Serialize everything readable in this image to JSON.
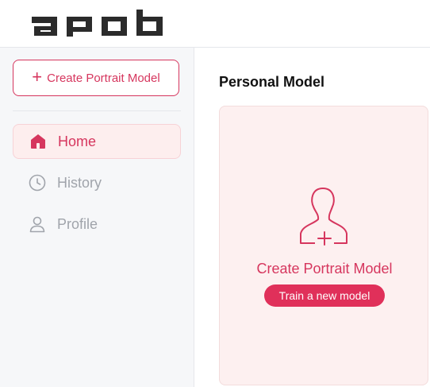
{
  "app": {
    "logo_text": "apob"
  },
  "sidebar": {
    "create_button_label": "Create Portrait Model",
    "items": [
      {
        "label": "Home",
        "icon": "home-icon",
        "active": true
      },
      {
        "label": "History",
        "icon": "clock-icon",
        "active": false
      },
      {
        "label": "Profile",
        "icon": "user-icon",
        "active": false
      }
    ]
  },
  "main": {
    "section_title": "Personal Model",
    "card": {
      "icon": "portrait-add-icon",
      "title": "Create Portrait Model",
      "button_label": "Train a new model"
    }
  },
  "colors": {
    "accent": "#d6365e",
    "accent_button": "#e0305a",
    "card_bg": "#fdf0f0",
    "sidebar_bg": "#f6f7f9",
    "muted_text": "#a0a4ab"
  }
}
